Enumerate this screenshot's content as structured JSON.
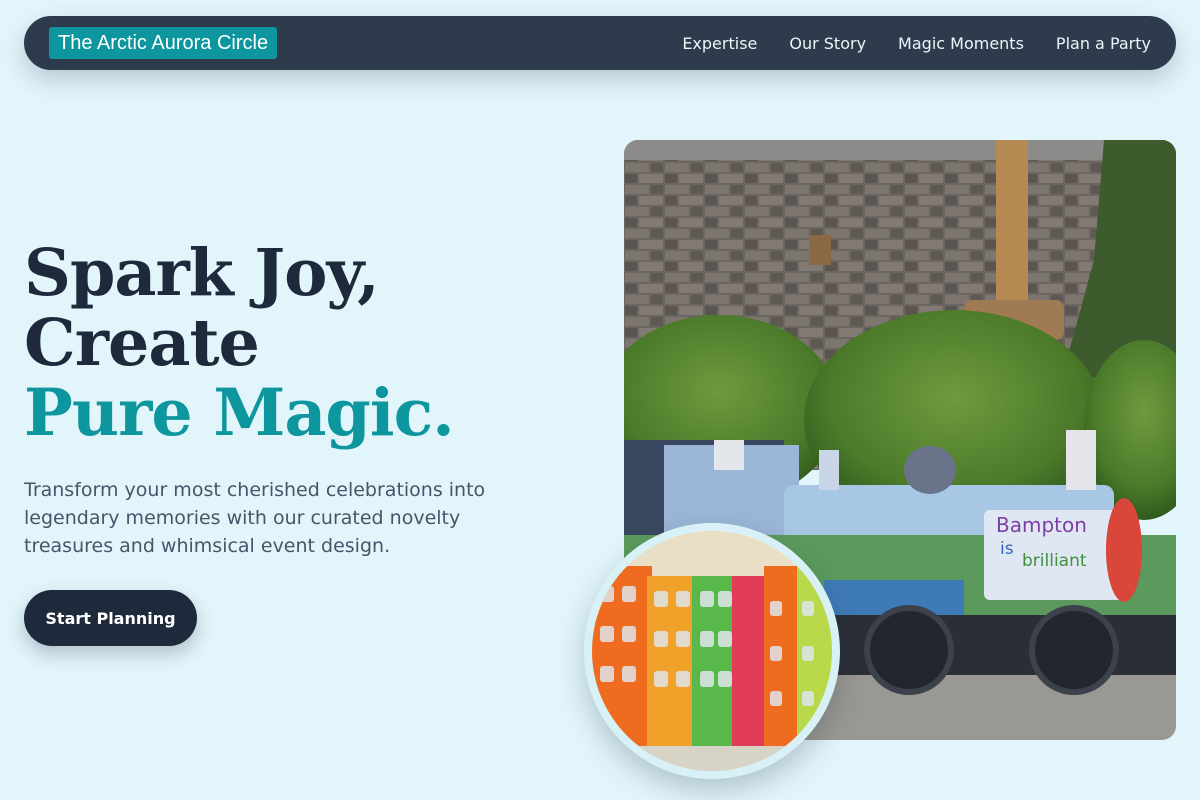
{
  "nav": {
    "brand": "The Arctic Aurora Circle",
    "links": [
      "Expertise",
      "Our Story",
      "Magic Moments",
      "Plan a Party"
    ]
  },
  "hero": {
    "headline": [
      "Spark Joy,",
      "Create",
      "Pure Magic."
    ],
    "subtitle": "Transform your most cherished celebrations into legendary memories with our curated novelty treasures and whimsical event design.",
    "cta_label": "Start Planning",
    "train_text": [
      "Bampton",
      "is",
      "brilliant"
    ]
  },
  "colors": {
    "background": "#e2f5fb",
    "navbar": "#2d3b4c",
    "accent": "#0e969f",
    "dark_text": "#1e293b",
    "body_text": "#475569"
  }
}
